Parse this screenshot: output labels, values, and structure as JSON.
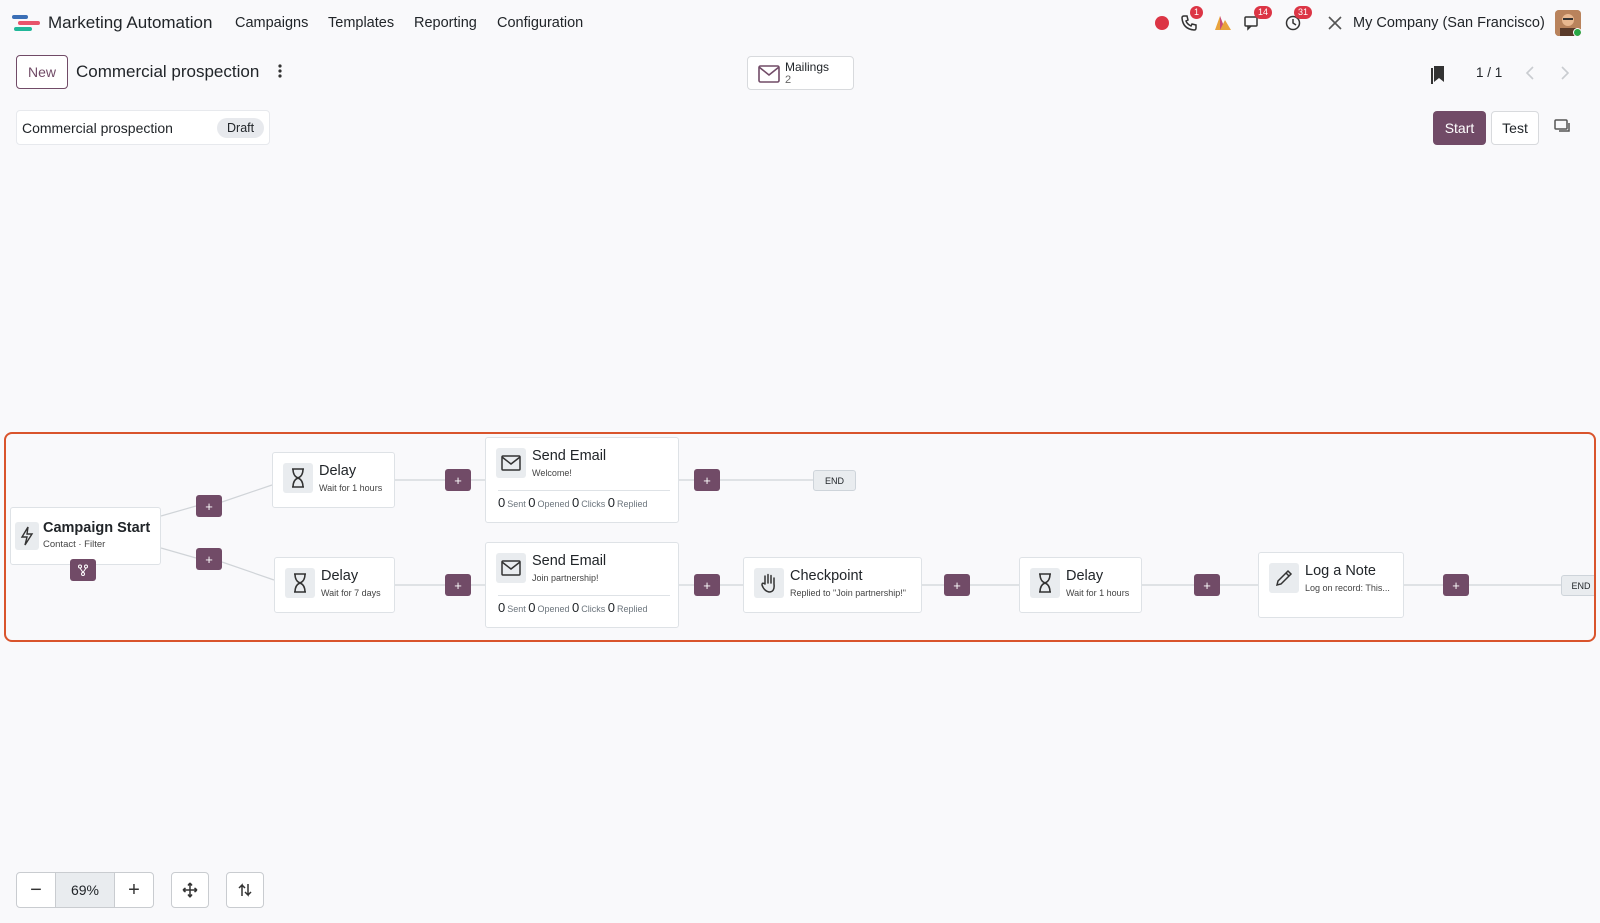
{
  "nav": {
    "app_name": "Marketing Automation",
    "menu": [
      "Campaigns",
      "Templates",
      "Reporting",
      "Configuration"
    ],
    "badges": {
      "phone": "1",
      "messages": "14",
      "activities": "31"
    },
    "company": "My Company (San Francisco)",
    "icons": [
      "record-dot-icon",
      "phone-icon",
      "ai-icon",
      "chat-icon",
      "clock-icon",
      "tools-icon"
    ]
  },
  "control": {
    "new_label": "New",
    "title": "Commercial prospection",
    "mailings_label": "Mailings",
    "mailings_count": "2",
    "pager": "1 / 1"
  },
  "campaign": {
    "name": "Commercial prospection",
    "status": "Draft",
    "start_label": "Start",
    "test_label": "Test"
  },
  "workflow": {
    "start": {
      "title": "Campaign Start",
      "sub": "Contact · Filter"
    },
    "stat_labels": {
      "sent": "Sent",
      "opened": "Opened",
      "clicks": "Clicks",
      "replied": "Replied"
    },
    "nodes": [
      {
        "title": "Delay",
        "sub": "Wait for 1 hours"
      },
      {
        "title": "Send Email",
        "sub": "Welcome!",
        "sent": "0",
        "opened": "0",
        "clicks": "0",
        "replied": "0"
      },
      {
        "title": "Delay",
        "sub": "Wait for 7 days"
      },
      {
        "title": "Send Email",
        "sub": "Join partnership!",
        "sent": "0",
        "opened": "0",
        "clicks": "0",
        "replied": "0"
      },
      {
        "title": "Checkpoint",
        "sub": "Replied to \"Join partnership!\""
      },
      {
        "title": "Delay",
        "sub": "Wait for 1 hours"
      },
      {
        "title": "Log a Note",
        "sub": "Log on record: This..."
      }
    ],
    "plus_label": "+",
    "end_label": "END"
  },
  "zoom": {
    "value": "69%",
    "minus": "−",
    "plus": "+"
  },
  "colors": {
    "brand": "#714b67",
    "highlight_border": "#d9542c",
    "badge": "#dc3545"
  }
}
